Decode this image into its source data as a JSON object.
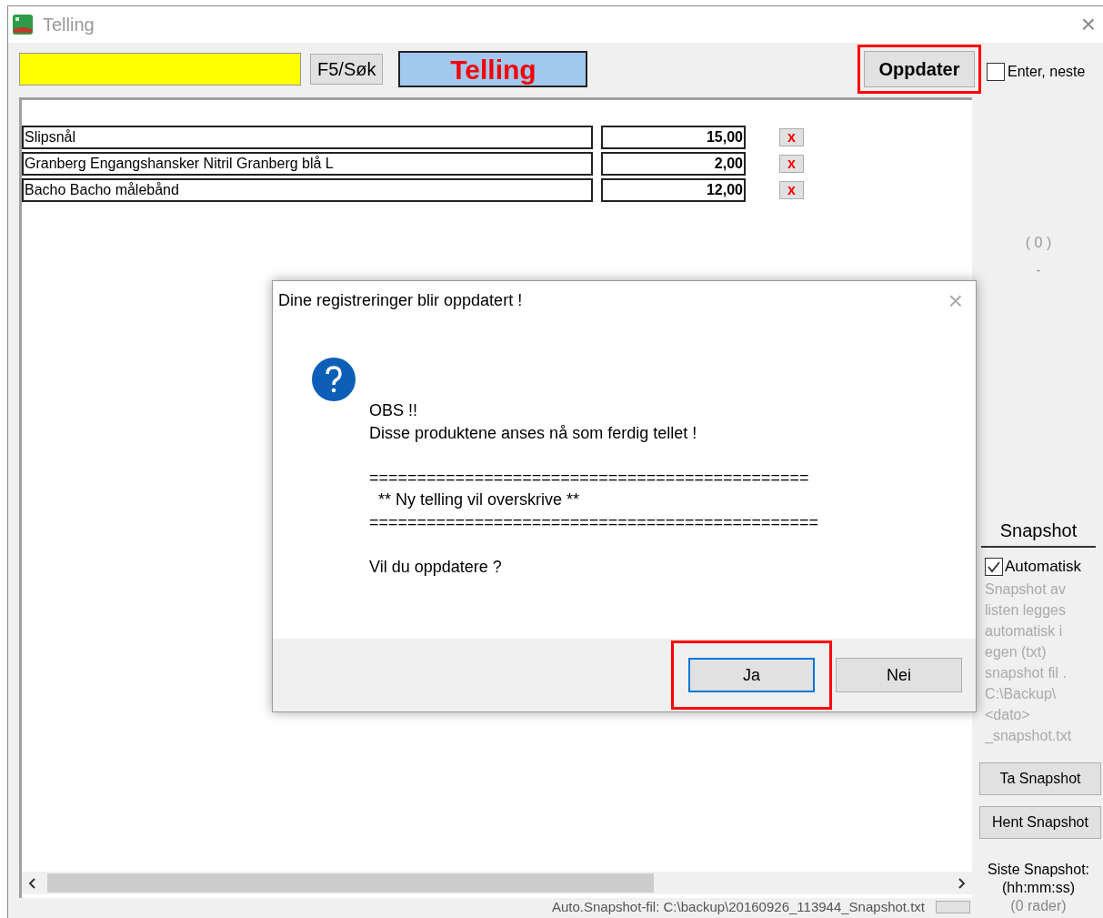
{
  "window": {
    "title": "Telling",
    "close": "×"
  },
  "toolbar": {
    "search_button": "F5/Søk",
    "heading": "Telling",
    "update_button": {
      "label": "Oppdater",
      "highlighted": true
    },
    "enter_next": {
      "label": "Enter, neste",
      "checked": false
    }
  },
  "rows": [
    {
      "name": "Slipsnål",
      "quantity": "15,00",
      "delete": "x"
    },
    {
      "name": "Granberg Engangshansker Nitril Granberg blå L",
      "quantity": "2,00",
      "delete": "x"
    },
    {
      "name": "Bacho Bacho målebånd",
      "quantity": "12,00",
      "delete": "x"
    }
  ],
  "counter": {
    "count": "( 0 )",
    "dash": "-"
  },
  "snapshot": {
    "title": "Snapshot",
    "automatic": {
      "label": "Automatisk",
      "checked": true
    },
    "description": "Snapshot av\nlisten legges\nautomatisk i\negen (txt)\nsnapshot fil .\nC:\\Backup\\\n<dato>\n_snapshot.txt",
    "buttons": [
      "Ta Snapshot",
      "Hent Snapshot"
    ],
    "last_label": "Siste Snapshot:",
    "time_format": "(hh:mm:ss)",
    "rows_count": "(0 rader)"
  },
  "status_bar": {
    "text": "Auto.Snapshot-fil: C:\\backup\\20160926_113944_Snapshot.txt"
  },
  "dialog": {
    "title": "Dine registreringer blir oppdatert !",
    "close": "×",
    "message_blocks": [
      [
        "OBS !!",
        "Disse produktene anses nå som ferdig tellet !"
      ],
      [
        "==============================================",
        "  ** Ny telling vil overskrive **",
        "==============================================="
      ],
      [
        "Vil du oppdatere ?"
      ]
    ],
    "buttons": [
      {
        "label": "Ja",
        "focused": true,
        "highlighted": true
      },
      {
        "label": "Nei",
        "focused": false,
        "highlighted": false
      }
    ]
  }
}
